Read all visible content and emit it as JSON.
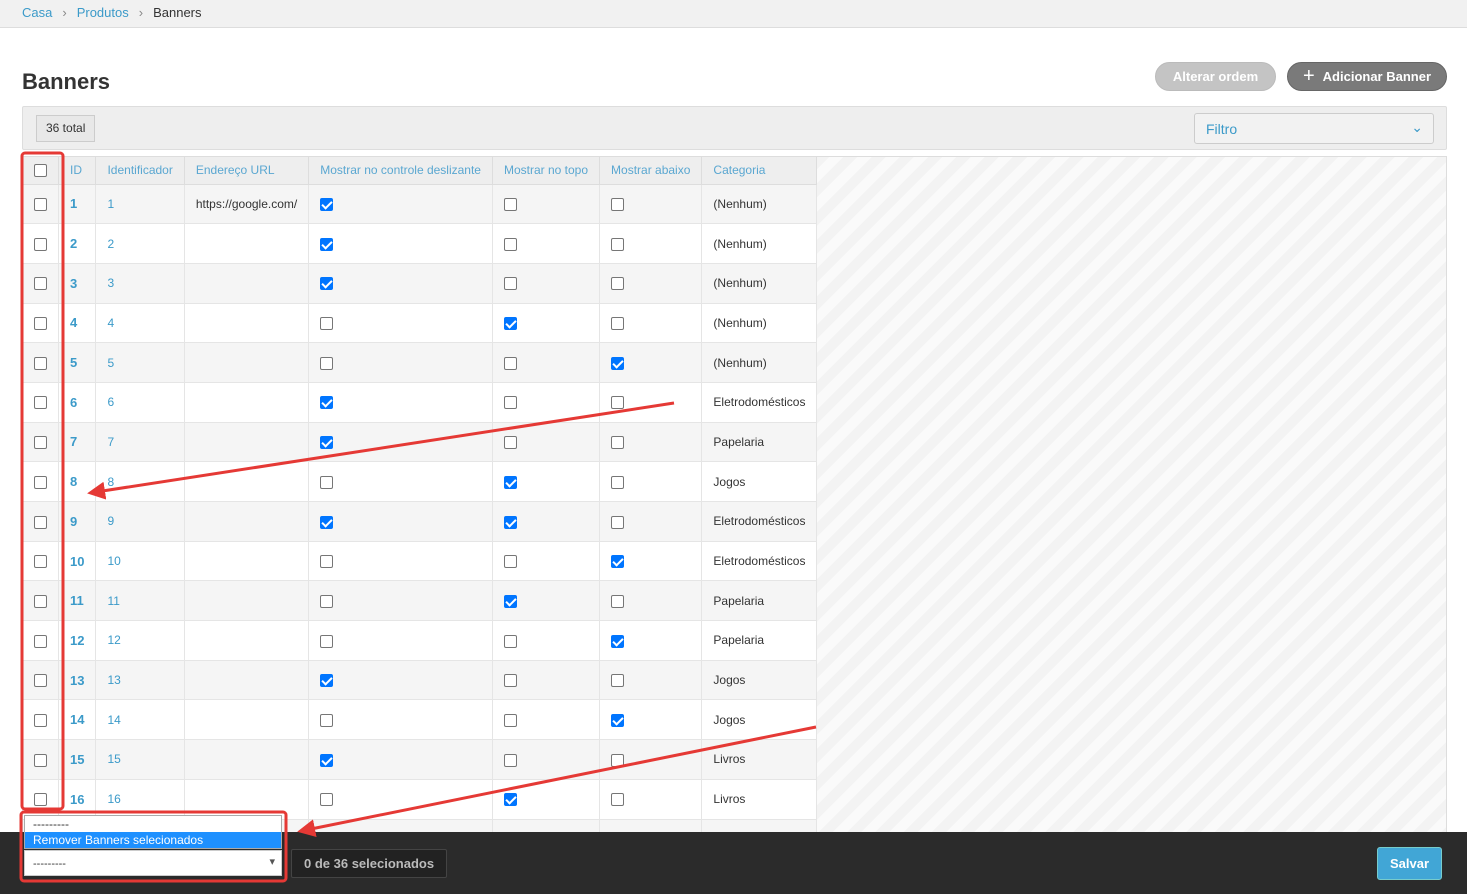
{
  "breadcrumb": [
    "Casa",
    "Produtos",
    "Banners"
  ],
  "page_title": "Banners",
  "buttons": {
    "reorder": "Alterar ordem",
    "add": "Adicionar Banner",
    "save": "Salvar"
  },
  "toolbar": {
    "total": "36 total",
    "filter": "Filtro"
  },
  "table": {
    "columns": [
      "ID",
      "Identificador",
      "Endereço URL",
      "Mostrar no controle deslizante",
      "Mostrar no topo",
      "Mostrar abaixo",
      "Categoria"
    ],
    "rows": [
      {
        "id": "1",
        "ident": "1",
        "url": "https://google.com/",
        "slider": true,
        "top": false,
        "below": false,
        "cat": "(Nenhum)"
      },
      {
        "id": "2",
        "ident": "2",
        "url": "",
        "slider": true,
        "top": false,
        "below": false,
        "cat": "(Nenhum)"
      },
      {
        "id": "3",
        "ident": "3",
        "url": "",
        "slider": true,
        "top": false,
        "below": false,
        "cat": "(Nenhum)"
      },
      {
        "id": "4",
        "ident": "4",
        "url": "",
        "slider": false,
        "top": true,
        "below": false,
        "cat": "(Nenhum)"
      },
      {
        "id": "5",
        "ident": "5",
        "url": "",
        "slider": false,
        "top": false,
        "below": true,
        "cat": "(Nenhum)"
      },
      {
        "id": "6",
        "ident": "6",
        "url": "",
        "slider": true,
        "top": false,
        "below": false,
        "cat": "Eletrodomésticos"
      },
      {
        "id": "7",
        "ident": "7",
        "url": "",
        "slider": true,
        "top": false,
        "below": false,
        "cat": "Papelaria"
      },
      {
        "id": "8",
        "ident": "8",
        "url": "",
        "slider": false,
        "top": true,
        "below": false,
        "cat": "Jogos"
      },
      {
        "id": "9",
        "ident": "9",
        "url": "",
        "slider": true,
        "top": true,
        "below": false,
        "cat": "Eletrodomésticos"
      },
      {
        "id": "10",
        "ident": "10",
        "url": "",
        "slider": false,
        "top": false,
        "below": true,
        "cat": "Eletrodomésticos"
      },
      {
        "id": "11",
        "ident": "11",
        "url": "",
        "slider": false,
        "top": true,
        "below": false,
        "cat": "Papelaria"
      },
      {
        "id": "12",
        "ident": "12",
        "url": "",
        "slider": false,
        "top": false,
        "below": true,
        "cat": "Papelaria"
      },
      {
        "id": "13",
        "ident": "13",
        "url": "",
        "slider": true,
        "top": false,
        "below": false,
        "cat": "Jogos"
      },
      {
        "id": "14",
        "ident": "14",
        "url": "",
        "slider": false,
        "top": false,
        "below": true,
        "cat": "Jogos"
      },
      {
        "id": "15",
        "ident": "15",
        "url": "",
        "slider": true,
        "top": false,
        "below": false,
        "cat": "Livros"
      },
      {
        "id": "16",
        "ident": "16",
        "url": "",
        "slider": false,
        "top": true,
        "below": false,
        "cat": "Livros"
      },
      {
        "id": "",
        "ident": "",
        "url": "",
        "slider": false,
        "top": false,
        "below": true,
        "cat": ""
      }
    ]
  },
  "actions": {
    "selected": "---------",
    "options": [
      "---------",
      "Remover Banners selecionados"
    ],
    "count": "0 de 36 selecionados"
  },
  "colors": {
    "link": "#3b9ac9",
    "checkbox": "#0075ff",
    "annotation": "#e53935",
    "save": "#41a6d6"
  }
}
